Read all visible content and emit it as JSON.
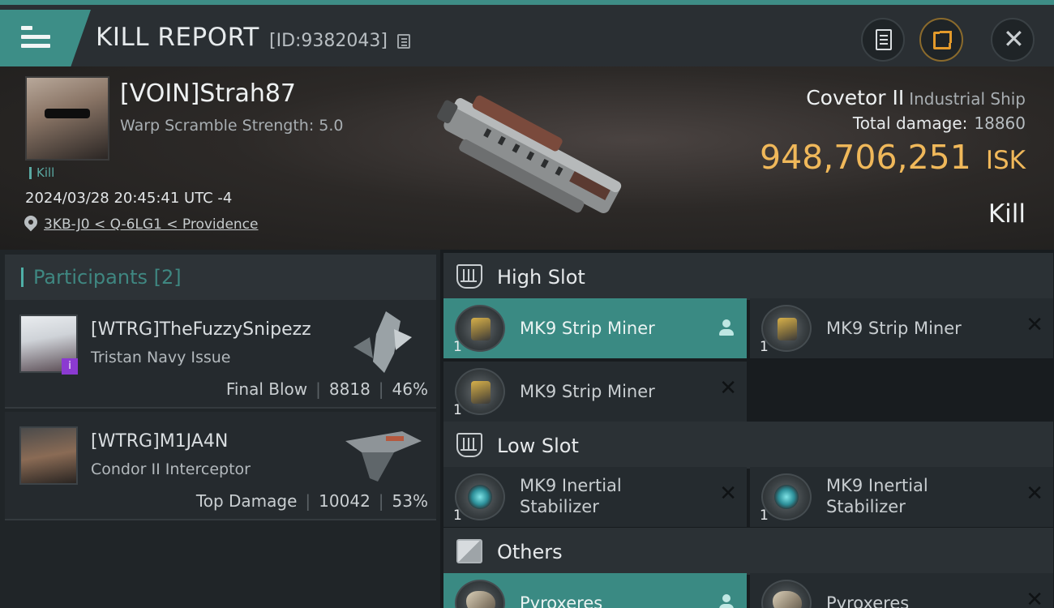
{
  "header": {
    "title": "KILL REPORT",
    "report_id": "[ID:9382043]"
  },
  "victim": {
    "name": "[VOIN]Strah87",
    "subtitle": "Warp Scramble Strength: 5.0",
    "kill_tag": "Kill",
    "timestamp": "2024/03/28 20:45:41 UTC -4",
    "location": "3KB-J0 < Q-6LG1 < Providence",
    "ship_name": "Covetor II",
    "ship_class": "Industrial Ship",
    "total_damage_label": "Total damage:",
    "total_damage": "18860",
    "isk_value": "948,706,251",
    "isk_unit": "ISK",
    "result": "Kill"
  },
  "participants": {
    "title": "Participants [2]",
    "items": [
      {
        "name": "[WTRG]TheFuzzySnipezz",
        "ship": "Tristan Navy Issue",
        "role": "Final Blow",
        "damage": "8818",
        "percent": "46%",
        "badge": "i"
      },
      {
        "name": "[WTRG]M1JA4N",
        "ship": "Condor II Interceptor",
        "role": "Top Damage",
        "damage": "10042",
        "percent": "53%"
      }
    ]
  },
  "fitting": {
    "high_slot": {
      "label": "High Slot",
      "modules": [
        {
          "name": "MK9 Strip Miner",
          "qty": "1"
        },
        {
          "name": "MK9 Strip Miner",
          "qty": "1"
        },
        {
          "name": "MK9 Strip Miner",
          "qty": "1"
        }
      ]
    },
    "low_slot": {
      "label": "Low Slot",
      "modules": [
        {
          "name_line1": "MK9 Inertial",
          "name_line2": "Stabilizer",
          "qty": "1"
        },
        {
          "name_line1": "MK9 Inertial",
          "name_line2": "Stabilizer",
          "qty": "1"
        }
      ]
    },
    "others": {
      "label": "Others",
      "modules": [
        {
          "name": "Pyroxeres"
        },
        {
          "name": "Pyroxeres"
        }
      ]
    }
  },
  "colors": {
    "accent": "#3d8e87",
    "isk": "#f0b85a",
    "final_blow_badge": "#8b3ad1"
  },
  "icons": {
    "menu": "hamburger-icon",
    "copy": "copy-icon",
    "clipboard": "clipboard-icon",
    "share": "share-icon",
    "close": "close-icon",
    "location": "location-pin-icon",
    "high_slot": "high-slot-icon",
    "low_slot": "low-slot-icon",
    "others": "cargo-box-icon",
    "dropped_by": "person-icon",
    "destroyed": "cross-icon"
  }
}
